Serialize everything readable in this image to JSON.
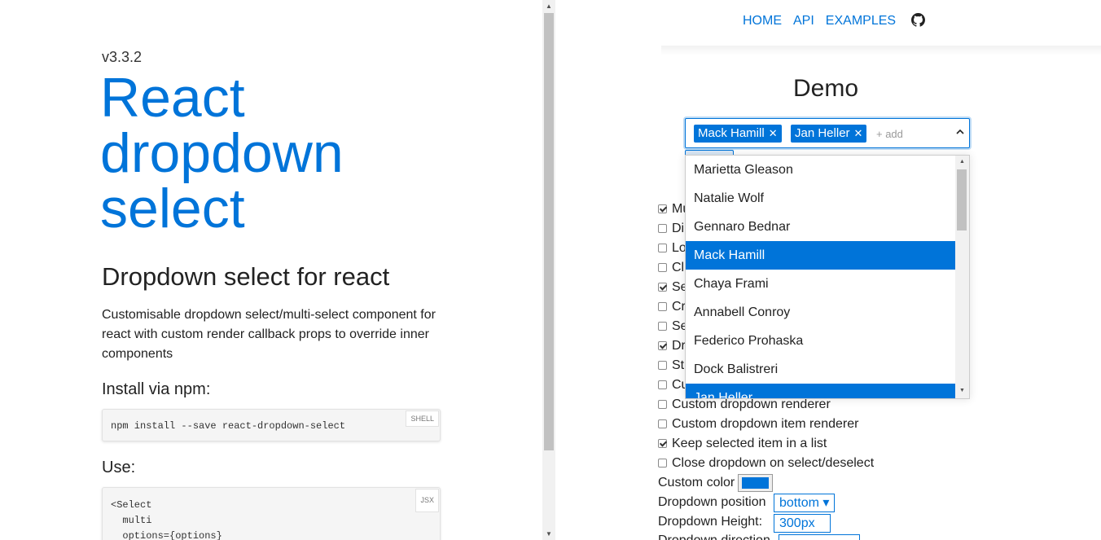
{
  "left": {
    "version": "v3.3.2",
    "hero_lines": [
      "React",
      "dropdown",
      "select"
    ],
    "subtitle": "Dropdown select for react",
    "description": "Customisable dropdown select/multi-select component for react with custom render callback props to override inner components",
    "install_heading": "Install via npm:",
    "install_code": "npm install --save react-dropdown-select",
    "install_lang": "SHELL",
    "use_heading": "Use:",
    "use_code": "<Select\n  multi\n  options={options}",
    "use_lang": "JSX"
  },
  "nav": {
    "items": [
      "HOME",
      "API",
      "EXAMPLES"
    ],
    "github_icon": "github-icon"
  },
  "demo": {
    "title": "Demo",
    "selected_tags": [
      "Mack Hamill",
      "Jan Heller"
    ],
    "add_placeholder": "+ add",
    "dropdown_items": [
      "Marietta Gleason",
      "Natalie Wolf",
      "Gennaro Bednar",
      "Mack Hamill",
      "Chaya Frami",
      "Annabell Conroy",
      "Federico Prohaska",
      "Dock Balistreri",
      "Jan Heller"
    ],
    "selected_items": [
      "Mack Hamill",
      "Jan Heller"
    ],
    "option_prefixes": [
      {
        "text": "Mu",
        "checked": true
      },
      {
        "text": "Di",
        "checked": false
      },
      {
        "text": "Lo",
        "checked": false
      },
      {
        "text": "Cl",
        "checked": false
      },
      {
        "text": "Se",
        "checked": true
      },
      {
        "text": "Cr",
        "checked": false
      },
      {
        "text": "Se",
        "checked": false
      },
      {
        "text": "Dr",
        "checked": true
      },
      {
        "text": "St",
        "checked": false
      },
      {
        "text": "Cu",
        "checked": false
      }
    ],
    "options_full": [
      {
        "text": "Custom dropdown renderer",
        "checked": false
      },
      {
        "text": "Custom dropdown item renderer",
        "checked": false
      },
      {
        "text": "Keep selected item in a list",
        "checked": true
      },
      {
        "text": "Close dropdown on select/deselect",
        "checked": false
      }
    ],
    "custom_color_label": "Custom color",
    "custom_color": "#0074d9",
    "dropdown_position_label": "Dropdown position",
    "dropdown_position_value": "bottom ▾",
    "dropdown_height_label": "Dropdown Height:",
    "dropdown_height_value": "300px"
  },
  "colors": {
    "accent": "#0074d9"
  }
}
